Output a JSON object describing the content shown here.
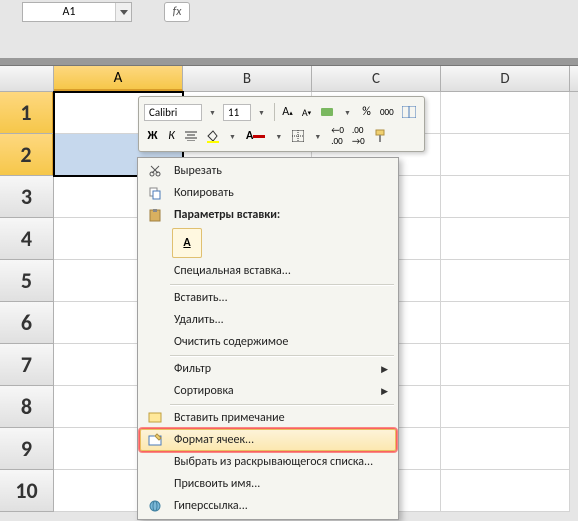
{
  "name_box": {
    "value": "A1"
  },
  "fx_label": "fx",
  "columns": [
    "A",
    "B",
    "C",
    "D"
  ],
  "rows": [
    "1",
    "2",
    "3",
    "4",
    "5",
    "6",
    "7",
    "8",
    "9",
    "10"
  ],
  "selection": {
    "primary": "A1",
    "range_end": "A2"
  },
  "mini_toolbar": {
    "font_name": "Calibri",
    "font_size": "11",
    "percent": "%",
    "thousand": "000"
  },
  "context_menu": {
    "cut": "Вырезать",
    "copy": "Копировать",
    "paste_params_header": "Параметры вставки:",
    "paste_special": "Специальная вставка...",
    "insert": "Вставить...",
    "delete": "Удалить...",
    "clear": "Очистить содержимое",
    "filter": "Фильтр",
    "sort": "Сортировка",
    "insert_comment": "Вставить примечание",
    "format_cells": "Формат ячеек...",
    "dropdown_select": "Выбрать из раскрывающегося списка...",
    "define_name": "Присвоить имя...",
    "hyperlink": "Гиперссылка..."
  }
}
